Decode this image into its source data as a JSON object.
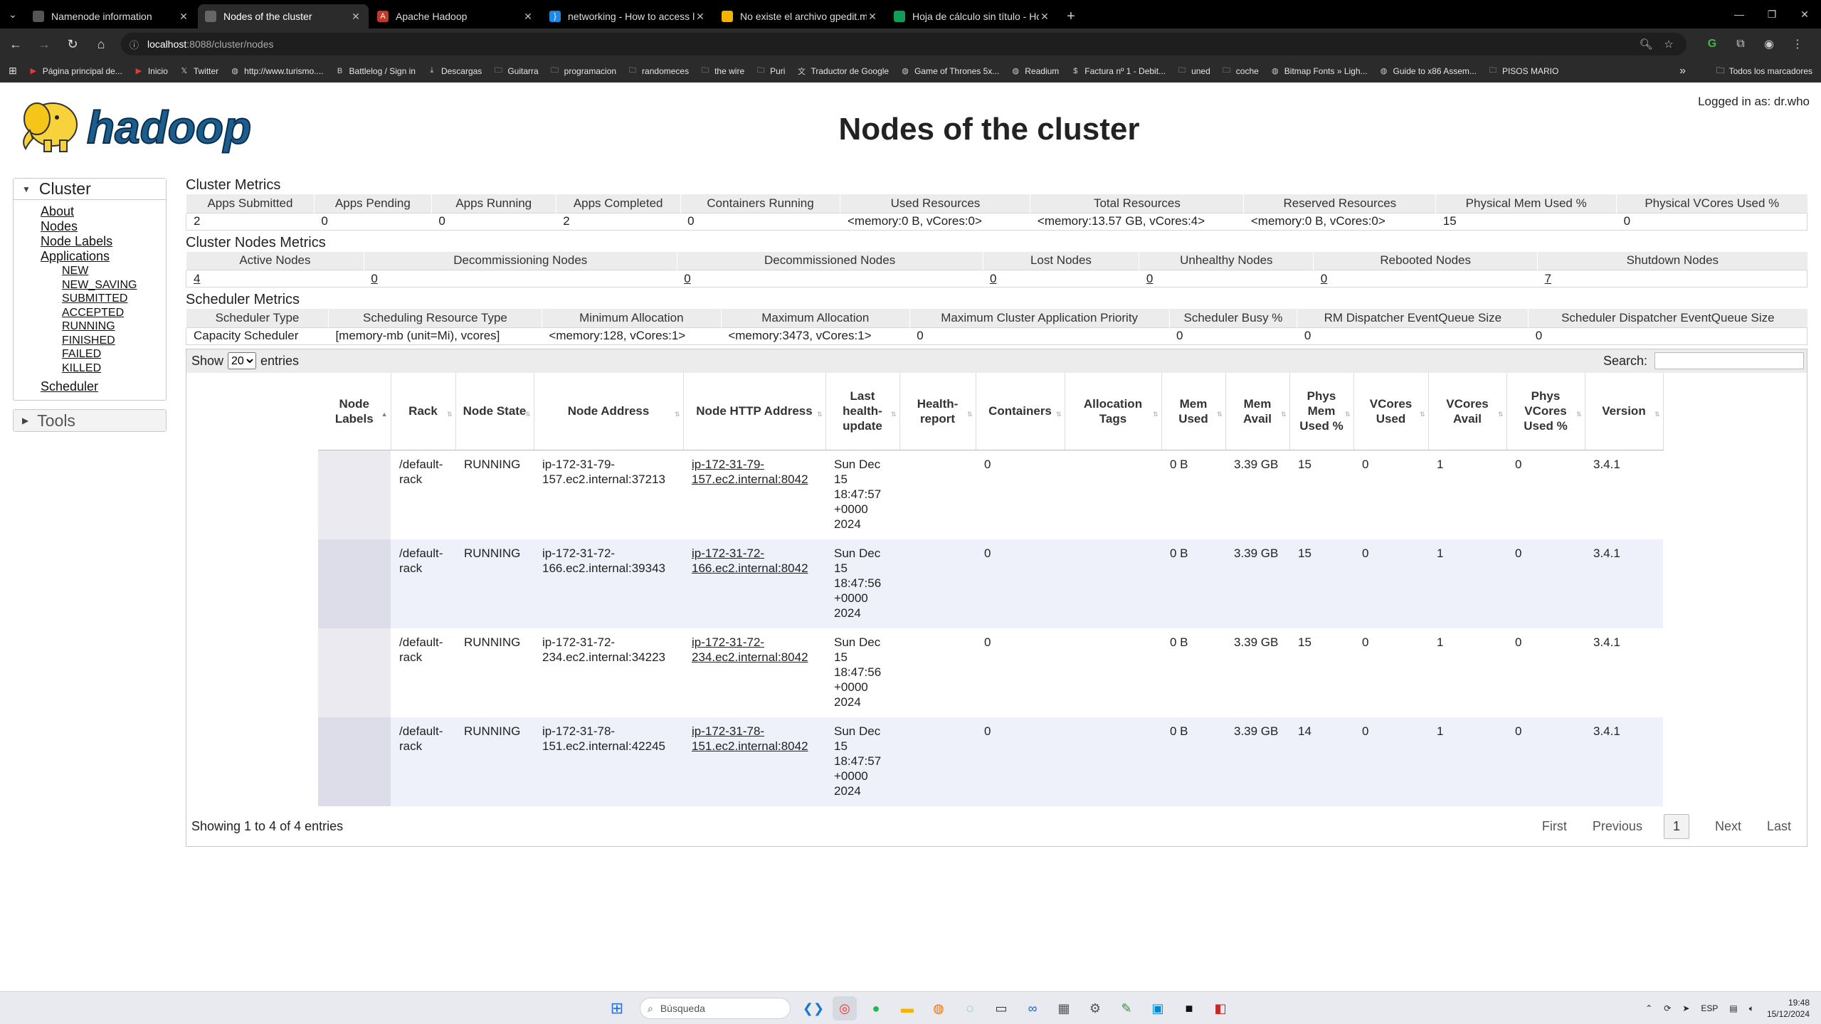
{
  "browser": {
    "tabs": [
      {
        "label": "Namenode information",
        "fav_color": "#555555",
        "fav_glyph": "",
        "active": false
      },
      {
        "label": "Nodes of the cluster",
        "fav_color": "#666666",
        "fav_glyph": "",
        "active": true
      },
      {
        "label": "Apache Hadoop",
        "fav_color": "#c0392b",
        "fav_glyph": "A",
        "active": false
      },
      {
        "label": "networking - How to access loc",
        "fav_color": "#1e88e5",
        "fav_glyph": "}",
        "active": false
      },
      {
        "label": "No existe el archivo gpedit.msc",
        "fav_color": "#f4b400",
        "fav_glyph": "",
        "active": false
      },
      {
        "label": "Hoja de cálculo sin título - Hoja",
        "fav_color": "#0f9d58",
        "fav_glyph": "",
        "active": false
      }
    ],
    "url_host": "localhost",
    "url_path": ":8088/cluster/nodes",
    "bookmarks": [
      {
        "label": "Página principal de...",
        "icon": "youtube-icon"
      },
      {
        "label": "Inicio",
        "icon": "youtube-icon"
      },
      {
        "label": "Twitter",
        "icon": "x-icon"
      },
      {
        "label": "http://www.turismo....",
        "icon": "site-icon"
      },
      {
        "label": "Battlelog / Sign in",
        "icon": "battlelog-icon"
      },
      {
        "label": "Descargas",
        "icon": "download-icon"
      },
      {
        "label": "Guitarra",
        "icon": "folder-icon"
      },
      {
        "label": "programacion",
        "icon": "folder-icon"
      },
      {
        "label": "randomeces",
        "icon": "folder-icon"
      },
      {
        "label": "the wire",
        "icon": "folder-icon"
      },
      {
        "label": "Puri",
        "icon": "folder-icon"
      },
      {
        "label": "Traductor de Google",
        "icon": "translate-icon"
      },
      {
        "label": "Game of Thrones 5x...",
        "icon": "site-icon"
      },
      {
        "label": "Readium",
        "icon": "site-icon"
      },
      {
        "label": "Factura nº 1 - Debit...",
        "icon": "dollar-icon"
      },
      {
        "label": "uned",
        "icon": "folder-icon"
      },
      {
        "label": "coche",
        "icon": "folder-icon"
      },
      {
        "label": "Bitmap Fonts » Ligh...",
        "icon": "site-icon"
      },
      {
        "label": "Guide to x86 Assem...",
        "icon": "site-icon"
      },
      {
        "label": "PISOS MARIO",
        "icon": "folder-icon"
      }
    ],
    "all_bookmarks": "Todos los marcadores"
  },
  "page": {
    "title": "Nodes of the cluster",
    "logged_in": "Logged in as: dr.who",
    "logo_text": "hadoop"
  },
  "nav": {
    "cluster_label": "Cluster",
    "items": [
      "About",
      "Nodes",
      "Node Labels",
      "Applications"
    ],
    "app_states": [
      "NEW",
      "NEW_SAVING",
      "SUBMITTED",
      "ACCEPTED",
      "RUNNING",
      "FINISHED",
      "FAILED",
      "KILLED"
    ],
    "scheduler": "Scheduler",
    "tools_label": "Tools"
  },
  "cluster_metrics": {
    "title": "Cluster Metrics",
    "headers": [
      "Apps Submitted",
      "Apps Pending",
      "Apps Running",
      "Apps Completed",
      "Containers Running",
      "Used Resources",
      "Total Resources",
      "Reserved Resources",
      "Physical Mem Used %",
      "Physical VCores Used %"
    ],
    "values": [
      "2",
      "0",
      "0",
      "2",
      "0",
      "<memory:0 B, vCores:0>",
      "<memory:13.57 GB, vCores:4>",
      "<memory:0 B, vCores:0>",
      "15",
      "0"
    ]
  },
  "nodes_metrics": {
    "title": "Cluster Nodes Metrics",
    "headers": [
      "Active Nodes",
      "Decommissioning Nodes",
      "Decommissioned Nodes",
      "Lost Nodes",
      "Unhealthy Nodes",
      "Rebooted Nodes",
      "Shutdown Nodes"
    ],
    "values": [
      "4",
      "0",
      "0",
      "0",
      "0",
      "0",
      "7"
    ]
  },
  "scheduler_metrics": {
    "title": "Scheduler Metrics",
    "headers": [
      "Scheduler Type",
      "Scheduling Resource Type",
      "Minimum Allocation",
      "Maximum Allocation",
      "Maximum Cluster Application Priority",
      "Scheduler Busy %",
      "RM Dispatcher EventQueue Size",
      "Scheduler Dispatcher EventQueue Size"
    ],
    "values": [
      "Capacity Scheduler",
      "[memory-mb (unit=Mi), vcores]",
      "<memory:128, vCores:1>",
      "<memory:3473, vCores:1>",
      "0",
      "0",
      "0",
      "0"
    ]
  },
  "nodes_table": {
    "show_label": "Show",
    "entries_label": "entries",
    "page_size": "20",
    "search_label": "Search:",
    "headers": [
      "Node Labels",
      "Rack",
      "Node State",
      "Node Address",
      "Node HTTP Address",
      "Last health-update",
      "Health-report",
      "Containers",
      "Allocation Tags",
      "Mem Used",
      "Mem Avail",
      "Phys Mem Used %",
      "VCores Used",
      "VCores Avail",
      "Phys VCores Used %",
      "Version"
    ],
    "rows": [
      {
        "labels": "",
        "rack": "/default-rack",
        "state": "RUNNING",
        "address": "ip-172-31-79-157.ec2.internal:37213",
        "http": "ip-172-31-79-157.ec2.internal:8042",
        "last_update": "Sun Dec 15 18:47:57 +0000 2024",
        "health": "",
        "containers": "0",
        "tags": "",
        "mem_used": "0 B",
        "mem_avail": "3.39 GB",
        "phys_mem": "15",
        "vcores_used": "0",
        "vcores_avail": "1",
        "phys_vcores": "0",
        "version": "3.4.1"
      },
      {
        "labels": "",
        "rack": "/default-rack",
        "state": "RUNNING",
        "address": "ip-172-31-72-166.ec2.internal:39343",
        "http": "ip-172-31-72-166.ec2.internal:8042",
        "last_update": "Sun Dec 15 18:47:56 +0000 2024",
        "health": "",
        "containers": "0",
        "tags": "",
        "mem_used": "0 B",
        "mem_avail": "3.39 GB",
        "phys_mem": "15",
        "vcores_used": "0",
        "vcores_avail": "1",
        "phys_vcores": "0",
        "version": "3.4.1"
      },
      {
        "labels": "",
        "rack": "/default-rack",
        "state": "RUNNING",
        "address": "ip-172-31-72-234.ec2.internal:34223",
        "http": "ip-172-31-72-234.ec2.internal:8042",
        "last_update": "Sun Dec 15 18:47:56 +0000 2024",
        "health": "",
        "containers": "0",
        "tags": "",
        "mem_used": "0 B",
        "mem_avail": "3.39 GB",
        "phys_mem": "15",
        "vcores_used": "0",
        "vcores_avail": "1",
        "phys_vcores": "0",
        "version": "3.4.1"
      },
      {
        "labels": "",
        "rack": "/default-rack",
        "state": "RUNNING",
        "address": "ip-172-31-78-151.ec2.internal:42245",
        "http": "ip-172-31-78-151.ec2.internal:8042",
        "last_update": "Sun Dec 15 18:47:57 +0000 2024",
        "health": "",
        "containers": "0",
        "tags": "",
        "mem_used": "0 B",
        "mem_avail": "3.39 GB",
        "phys_mem": "14",
        "vcores_used": "0",
        "vcores_avail": "1",
        "phys_vcores": "0",
        "version": "3.4.1"
      }
    ],
    "footer_info": "Showing 1 to 4 of 4 entries",
    "pager": {
      "first": "First",
      "previous": "Previous",
      "current": "1",
      "next": "Next",
      "last": "Last"
    }
  },
  "taskbar": {
    "search_placeholder": "Búsqueda",
    "lang": "ESP",
    "time": "19:48",
    "date": "15/12/2024"
  }
}
